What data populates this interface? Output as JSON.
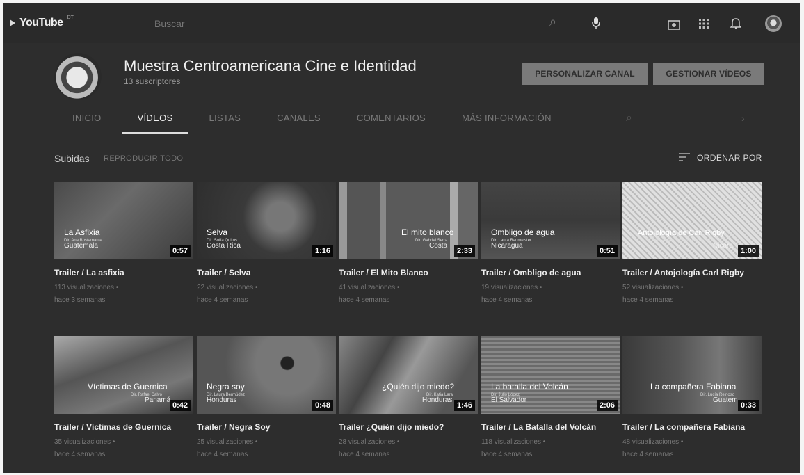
{
  "topbar": {
    "logo_text": "YouTube",
    "logo_sup": "DT",
    "search_placeholder": "Buscar"
  },
  "channel": {
    "title": "Muestra Centroamericana Cine e Identidad",
    "subscribers": "13 suscriptores",
    "customize_button": "PERSONALIZAR CANAL",
    "manage_button": "GESTIONAR VÍDEOS"
  },
  "tabs": [
    {
      "label": "INICIO"
    },
    {
      "label": "VÍDEOS"
    },
    {
      "label": "LISTAS"
    },
    {
      "label": "CANALES"
    },
    {
      "label": "COMENTARIOS"
    },
    {
      "label": "MÁS INFORMACIÓN"
    }
  ],
  "section": {
    "label": "Subidas",
    "play_all": "REPRODUCIR TODO",
    "sort": "ORDENAR POR"
  },
  "videos": [
    {
      "title": "Trailer / La asfixia",
      "thumb_title": "La Asfixia",
      "thumb_dir": "Dir. Ana Bustamante",
      "thumb_country": "Guatemala",
      "duration": "0:57",
      "views": "113 visualizaciones •",
      "age": "hace 3 semanas"
    },
    {
      "title": "Trailer / Selva",
      "thumb_title": "Selva",
      "thumb_dir": "Dir. Sofía Quirós",
      "thumb_country": "Costa Rica",
      "duration": "1:16",
      "views": "22 visualizaciones •",
      "age": "hace 4 semanas"
    },
    {
      "title": "Trailer / El Mito Blanco",
      "thumb_title": "El mito blanco",
      "thumb_dir": "Dir. Gabriel Serra",
      "thumb_country": "Costa",
      "duration": "2:33",
      "views": "41 visualizaciones •",
      "age": "hace 4 semanas"
    },
    {
      "title": "Trailer / Ombligo de agua",
      "thumb_title": "Ombligo de agua",
      "thumb_dir": "Dir. Laura Baumeister",
      "thumb_country": "Nicaragua",
      "duration": "0:51",
      "views": "19 visualizaciones •",
      "age": "hace 4 semanas"
    },
    {
      "title": "Trailer / Antojología Carl Rigby",
      "thumb_title": "Antojología de Carl Rigby",
      "thumb_dir": "Dir. Félix Álvarez / Eduardo Guerrero",
      "thumb_country": "Nicara",
      "duration": "1:00",
      "views": "52 visualizaciones •",
      "age": "hace 4 semanas"
    },
    {
      "title": "Trailer / Víctimas de Guernica",
      "thumb_title": "Víctimas de Guernica",
      "thumb_dir": "Dir. Rafael Calvo",
      "thumb_country": "Panamá",
      "duration": "0:42",
      "views": "35 visualizaciones •",
      "age": "hace 4 semanas"
    },
    {
      "title": "Trailer / Negra Soy",
      "thumb_title": "Negra soy",
      "thumb_dir": "Dir. Laura Bermúdez",
      "thumb_country": "Honduras",
      "duration": "0:48",
      "views": "25 visualizaciones •",
      "age": "hace 4 semanas"
    },
    {
      "title": "Trailer ¿Quién dijo miedo?",
      "thumb_title": "¿Quién dijo miedo?",
      "thumb_dir": "Dir. Katia Lara",
      "thumb_country": "Honduras",
      "duration": "1:46",
      "views": "28 visualizaciones •",
      "age": "hace 4 semanas"
    },
    {
      "title": "Trailer / La Batalla del Volcán",
      "thumb_title": "La batalla del Volcán",
      "thumb_dir": "Dir. Julio López",
      "thumb_country": "El Salvador",
      "duration": "2:06",
      "views": "118 visualizaciones •",
      "age": "hace 4 semanas"
    },
    {
      "title": "Trailer / La compañera Fabiana",
      "thumb_title": "La compañera Fabiana",
      "thumb_dir": "Dir. Lucía Reinoso",
      "thumb_country": "Guatem",
      "duration": "0:33",
      "views": "48 visualizaciones •",
      "age": "hace 4 semanas"
    }
  ]
}
